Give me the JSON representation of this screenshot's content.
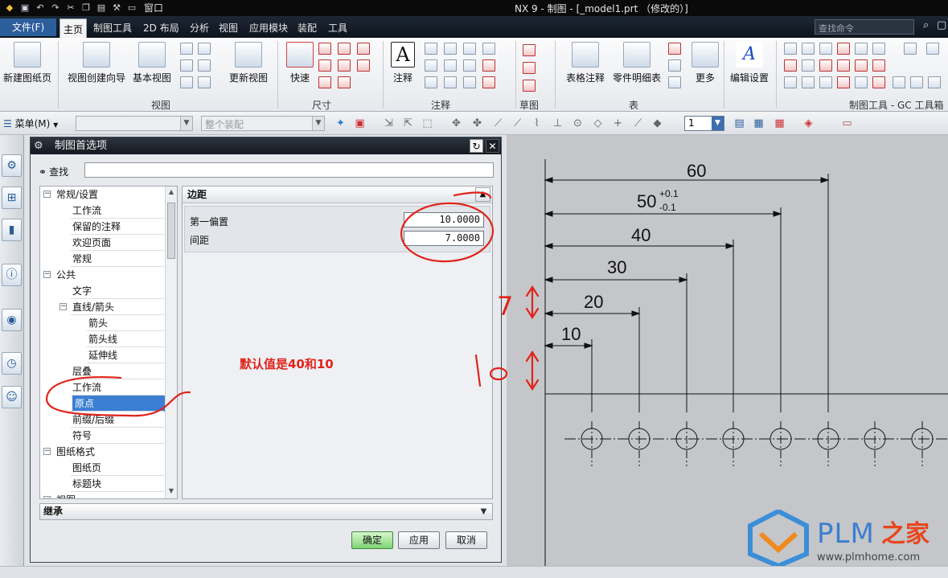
{
  "window": {
    "title": "NX 9 - 制图 - [_model1.prt （修改的）]",
    "window_menu": "窗口",
    "command_search_placeholder": "查找命令"
  },
  "ribbon_tabs": {
    "file": "文件(F)",
    "tabs": [
      "主页",
      "制图工具",
      "2D 布局",
      "分析",
      "视图",
      "应用模块",
      "装配",
      "工具"
    ],
    "active": "主页"
  },
  "ribbon": {
    "new_sheet": "新建图纸页",
    "view_wizard": "视图创建向导",
    "base_view": "基本视图",
    "update_view": "更新视图",
    "group_view": "视图",
    "rapid": "快速",
    "group_dimension": "尺寸",
    "note": "注释",
    "group_annotation": "注释",
    "group_sketch": "草图",
    "tabular_note": "表格注释",
    "parts_list": "零件明细表",
    "more": "更多",
    "group_table": "表",
    "edit_settings": "编辑设置",
    "group_gc": "制图工具 - GC 工具箱"
  },
  "toolbar": {
    "menu": "菜单(M)",
    "assembly_filter": "整个装配",
    "layer": "1"
  },
  "dialog": {
    "title": "制图首选项",
    "find_label": "查找",
    "find_value": "",
    "tree": [
      {
        "label": "常规/设置",
        "level": 0,
        "expander": "minus"
      },
      {
        "label": "工作流",
        "level": 1
      },
      {
        "label": "保留的注释",
        "level": 1
      },
      {
        "label": "欢迎页面",
        "level": 1
      },
      {
        "label": "常规",
        "level": 1
      },
      {
        "label": "公共",
        "level": 0,
        "expander": "minus"
      },
      {
        "label": "文字",
        "level": 1
      },
      {
        "label": "直线/箭头",
        "level": 1,
        "expander": "minus"
      },
      {
        "label": "箭头",
        "level": 2
      },
      {
        "label": "箭头线",
        "level": 2
      },
      {
        "label": "延伸线",
        "level": 2
      },
      {
        "label": "层叠",
        "level": 1
      },
      {
        "label": "工作流",
        "level": 1
      },
      {
        "label": "原点",
        "level": 1,
        "selected": true
      },
      {
        "label": "前缀/后缀",
        "level": 1
      },
      {
        "label": "符号",
        "level": 1
      },
      {
        "label": "图纸格式",
        "level": 0,
        "expander": "minus"
      },
      {
        "label": "图纸页",
        "level": 1
      },
      {
        "label": "标题块",
        "level": 1
      },
      {
        "label": "视图",
        "level": 0,
        "expander": "minus"
      }
    ],
    "section_title": "边距",
    "params": [
      {
        "label": "第一偏置",
        "value": "10.0000"
      },
      {
        "label": "间距",
        "value": "7.0000"
      }
    ],
    "inherit_label": "继承",
    "buttons": {
      "ok": "确定",
      "apply": "应用",
      "cancel": "取消"
    }
  },
  "drawing": {
    "dims": [
      {
        "text": "60"
      },
      {
        "text": "50",
        "upper_tol": "+0.1",
        "lower_tol": "-0.1"
      },
      {
        "text": "40"
      },
      {
        "text": "30"
      },
      {
        "text": "20"
      },
      {
        "text": "10"
      }
    ]
  },
  "annotations": {
    "default_note": "默认值是40和10",
    "hand_7": "7",
    "hand_10": "10"
  },
  "watermark": {
    "brand": "PLM",
    "brand_cn": "之家",
    "url": "www.plmhome.com"
  }
}
